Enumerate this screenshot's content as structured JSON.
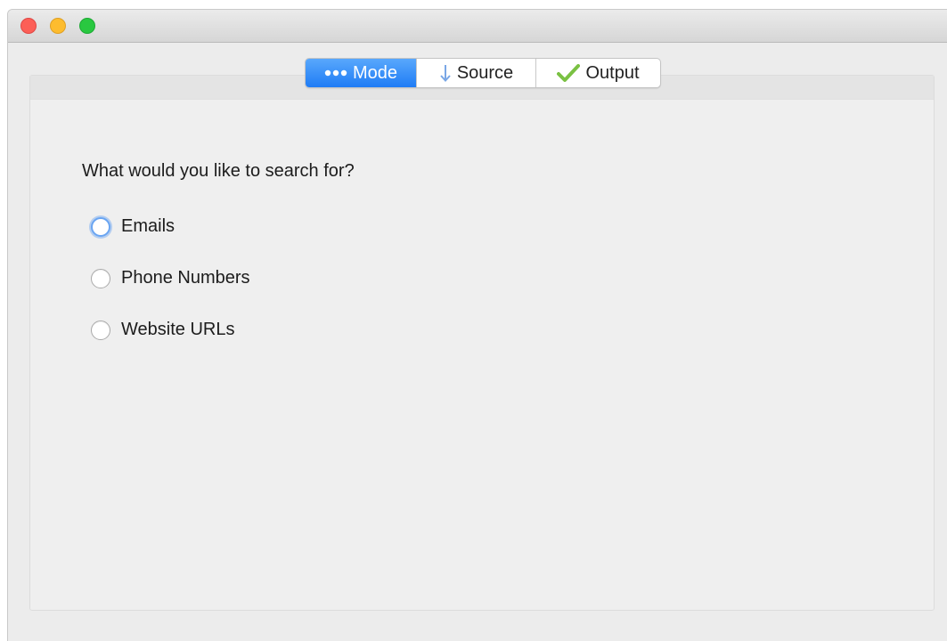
{
  "window": {
    "traffic_lights": [
      {
        "name": "close",
        "color": "#fc5f57"
      },
      {
        "name": "minimize",
        "color": "#fdbc2e"
      },
      {
        "name": "zoom",
        "color": "#29c840"
      }
    ]
  },
  "tabs": {
    "selected": "mode",
    "items": [
      {
        "id": "mode",
        "label": "Mode",
        "icon": "ellipsis-icon"
      },
      {
        "id": "source",
        "label": "Source",
        "icon": "arrow-down-icon"
      },
      {
        "id": "output",
        "label": "Output",
        "icon": "checkmark-icon"
      }
    ]
  },
  "colors": {
    "accent": "#1f7cf5",
    "checkmark": "#7ac143",
    "arrow": "#7aa7e6"
  },
  "mode_panel": {
    "question": "What would you like to search for?",
    "options": [
      {
        "id": "emails",
        "label": "Emails",
        "selected": false,
        "focused": true
      },
      {
        "id": "phone-numbers",
        "label": "Phone Numbers",
        "selected": false,
        "focused": false
      },
      {
        "id": "website-urls",
        "label": "Website URLs",
        "selected": false,
        "focused": false
      }
    ]
  }
}
